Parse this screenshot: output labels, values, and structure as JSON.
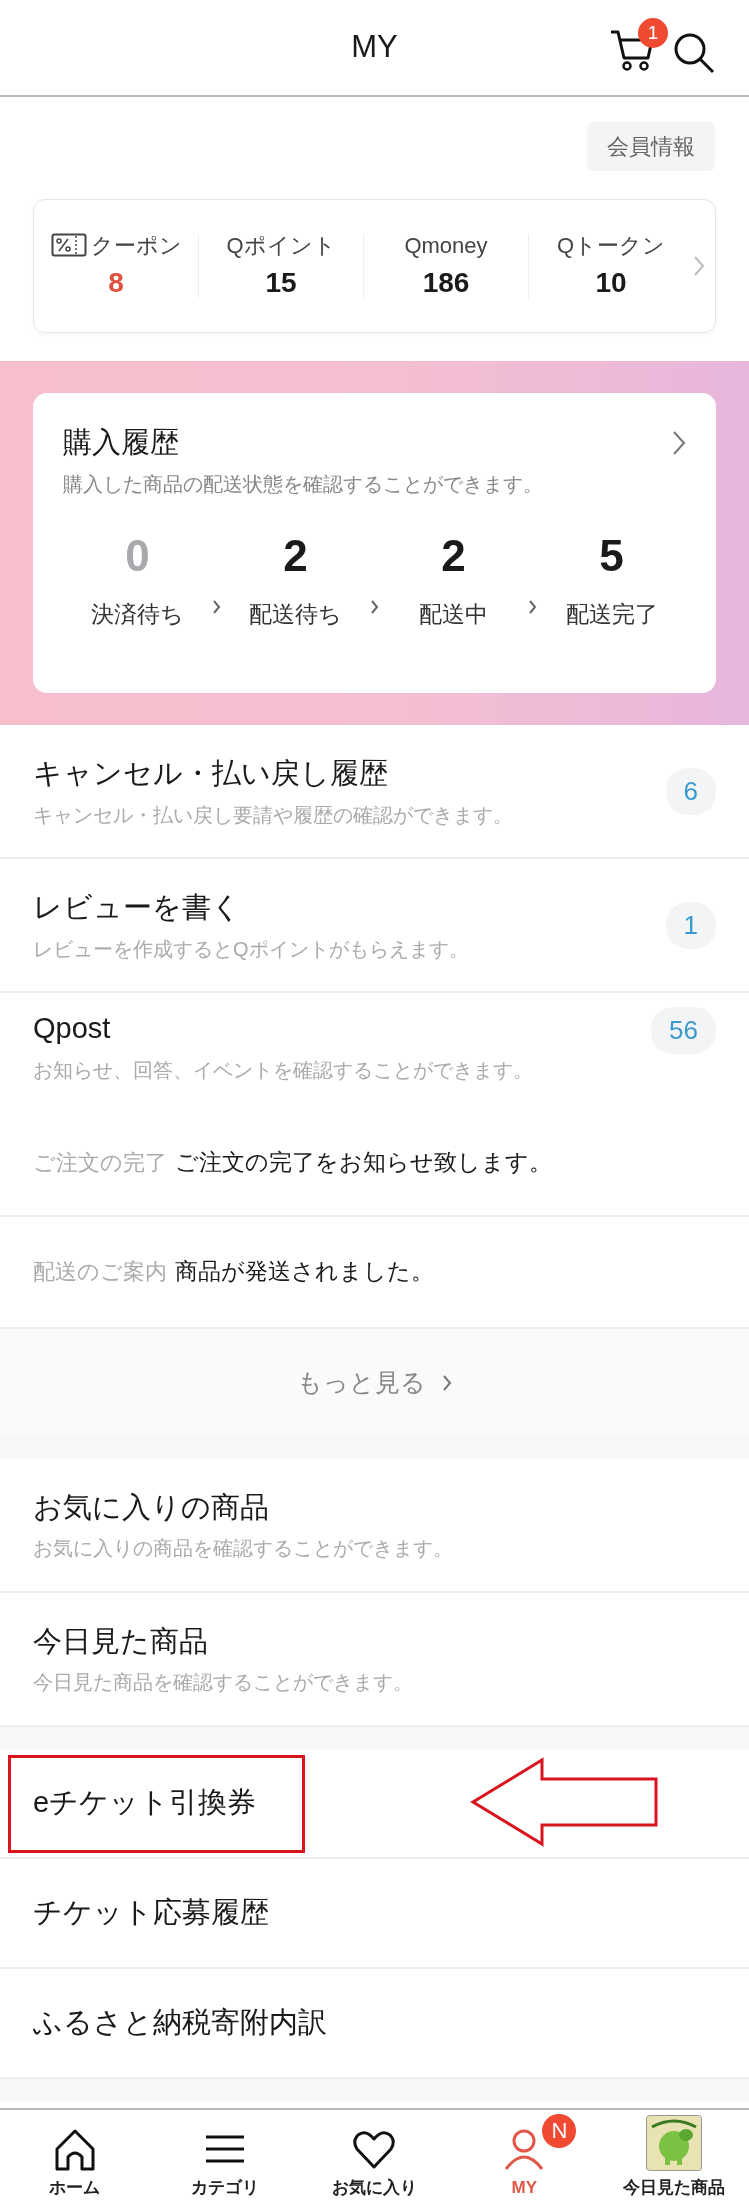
{
  "header": {
    "title": "MY",
    "cart_count": "1"
  },
  "member_button": "会員情報",
  "points": [
    {
      "kind": "coupon",
      "label": "クーポン",
      "value": "8"
    },
    {
      "kind": "plain",
      "label": "Qポイント",
      "value": "15"
    },
    {
      "kind": "plain",
      "label": "Qmoney",
      "value": "186"
    },
    {
      "kind": "plain",
      "label": "Qトークン",
      "value": "10"
    }
  ],
  "purchase": {
    "title": "購入履歴",
    "description": "購入した商品の配送状態を確認することができます。",
    "steps": [
      {
        "count": "0",
        "label": "決済待ち",
        "muted": true
      },
      {
        "count": "2",
        "label": "配送待ち",
        "muted": false
      },
      {
        "count": "2",
        "label": "配送中",
        "muted": false
      },
      {
        "count": "5",
        "label": "配送完了",
        "muted": false
      }
    ]
  },
  "sections": [
    {
      "rows": [
        {
          "kind": "item",
          "title": "キャンセル・払い戻し履歴",
          "subtitle": "キャンセル・払い戻し要請や履歴の確認ができます。",
          "count": "6"
        },
        {
          "kind": "item",
          "title": "レビューを書く",
          "subtitle": "レビューを作成するとQポイントがもらえます。",
          "count": "1"
        },
        {
          "kind": "item",
          "title": "Qpost",
          "subtitle": "お知らせ、回答、イベントを確認することができます。",
          "count": "56"
        },
        {
          "kind": "notice",
          "category": "ご注文の完了",
          "message": "ご注文の完了をお知らせ致します。"
        },
        {
          "kind": "notice",
          "category": "配送のご案内",
          "message": "商品が発送されました。"
        },
        {
          "kind": "more",
          "label": "もっと見る"
        }
      ]
    },
    {
      "rows": [
        {
          "kind": "item",
          "title": "お気に入りの商品",
          "subtitle": "お気に入りの商品を確認することができます。"
        },
        {
          "kind": "item",
          "title": "今日見た商品",
          "subtitle": "今日見た商品を確認することができます。"
        }
      ]
    },
    {
      "rows": [
        {
          "kind": "item",
          "title": "eチケット引換券",
          "highlighted": true
        },
        {
          "kind": "item",
          "title": "チケット応募履歴",
          "highlighted": false
        },
        {
          "kind": "item",
          "title": "ふるさと納税寄附内訳",
          "highlighted": false
        }
      ]
    }
  ],
  "bottom_nav": [
    {
      "kind": "home",
      "label": "ホーム",
      "selected": false
    },
    {
      "kind": "menu",
      "label": "カテゴリ",
      "selected": false
    },
    {
      "kind": "heart",
      "label": "お気に入り",
      "selected": false
    },
    {
      "kind": "person",
      "label": "MY",
      "selected": true,
      "badge": "N"
    },
    {
      "kind": "picture",
      "label": "今日見た商品",
      "selected": false
    }
  ]
}
